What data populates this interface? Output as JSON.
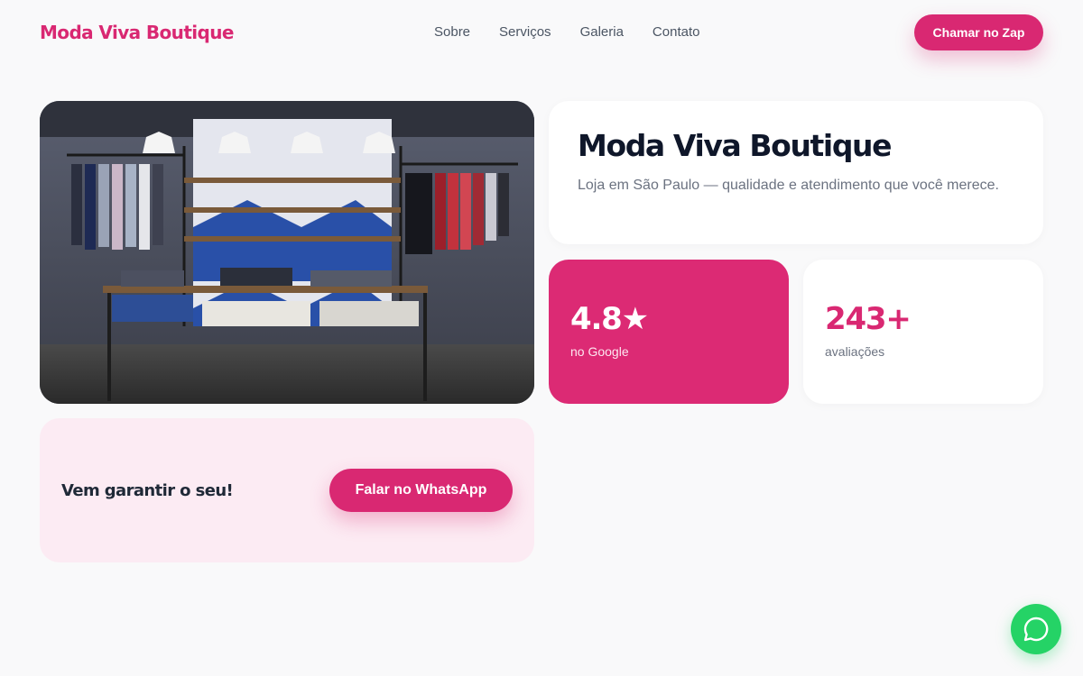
{
  "header": {
    "brand": "Moda Viva Boutique",
    "nav": [
      "Sobre",
      "Serviços",
      "Galeria",
      "Contato"
    ],
    "cta": "Chamar no Zap"
  },
  "hero": {
    "image_icon": "store-interior-photo",
    "title": "Moda Viva Boutique",
    "subtitle": "Loja em São Paulo — qualidade e atendimento que você merece."
  },
  "stats": [
    {
      "value": "4.8★",
      "label": "no Google"
    },
    {
      "value": "243+",
      "label": "avaliações"
    }
  ],
  "cta_card": {
    "text": "Vem garantir o seu!",
    "button": "Falar no WhatsApp"
  },
  "floating": {
    "icon": "whatsapp-icon"
  },
  "colors": {
    "brand": "#d92872",
    "background": "#f9f9fa",
    "cta_card_bg": "#fcebf3",
    "whatsapp": "#25d366"
  }
}
